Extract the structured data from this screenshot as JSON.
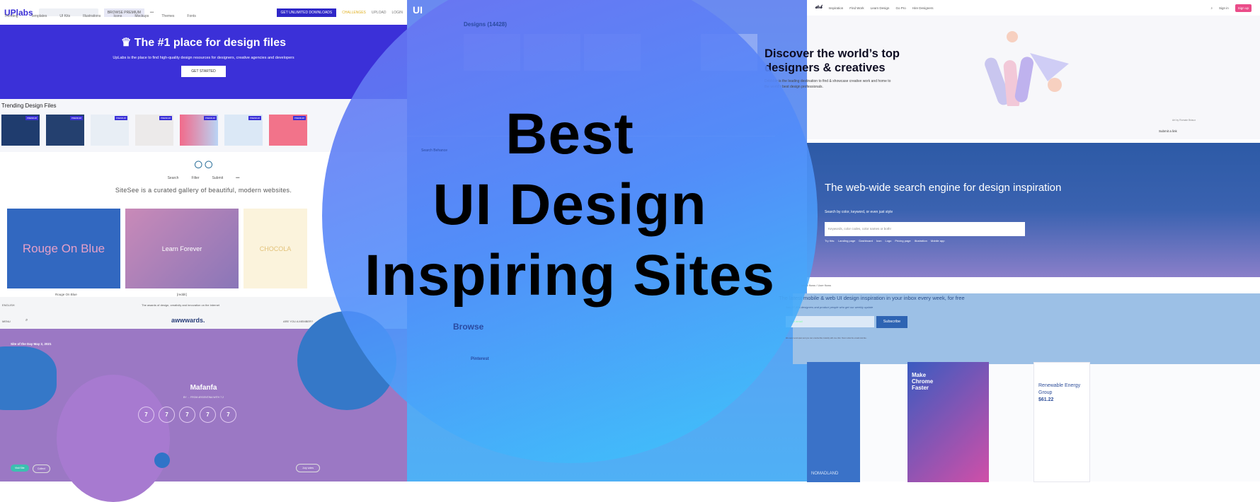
{
  "headline": {
    "line1": "Best",
    "line2": "UI Design",
    "line3": "Inspiring Sites"
  },
  "colors": {
    "circle_start": "#6e6ef0",
    "circle_end": "#3cc8fa",
    "uplabs_blue": "#3b30d8",
    "dribbble_pink": "#ea4c89"
  },
  "uplabs": {
    "logo": "UPlabs",
    "browse_premium": "BROWSE PREMIUM",
    "more": "•••",
    "get_unlimited": "GET UNLIMITED DOWNLOADS",
    "challenges": "CHALLENGES",
    "upload": "UPLOAD",
    "login": "LOGIN",
    "tabs": [
      "Trending",
      "Templates",
      "UI Kits",
      "Illustrations",
      "Icons",
      "Mockups",
      "Themes",
      "Fonts"
    ],
    "banner_title": "The #1 place for design files",
    "banner_text": "UpLabs is the place to find high-quality design resources for designers, creative agencies and developers",
    "cta": "GET STARTED",
    "trending_title": "Trending Design Files",
    "badge": "PREMIUM"
  },
  "sitesee": {
    "nav": [
      "Search",
      "Filter",
      "Submit",
      "•••"
    ],
    "tagline": "SiteSee is a curated gallery of beautiful, modern websites.",
    "shots": [
      {
        "title": "Rouge On Blue",
        "caption": "Rouge On Blue"
      },
      {
        "title": "Learn Forever",
        "caption": "[reddit]"
      },
      {
        "title": "CHOCOLA",
        "caption": ""
      }
    ]
  },
  "awwwards": {
    "language": "ENGLISH",
    "tagline": "The awards of design, creativity and innovation on the internet",
    "menu": "MENU",
    "logo": "awwwards.",
    "member": "ARE YOU A MEMBER?",
    "sotd": "Site of the Day May 2, 2021",
    "site": "Mafanfa",
    "byline": "BY … FROM ARGENTINA WITH 7.2",
    "scores": [
      "7",
      "7",
      "7",
      "7",
      "7"
    ],
    "visit": "Visit Site",
    "collect": "Collect",
    "jury": "Jury votes"
  },
  "middle": {
    "logo": "UI",
    "designs_title": "Designs (14428)",
    "search": "Search Behance",
    "browse": "Browse",
    "pinterest": "Pinterest"
  },
  "dribbble": {
    "nav": [
      "Inspiration",
      "Find Work",
      "Learn Design",
      "Go Pro",
      "Hire Designers"
    ],
    "signin": "Sign in",
    "signup": "Sign up",
    "title": "Discover the world’s top designers & creatives",
    "text": "Dribbble is the leading destination to find & showcase creative work and home to the world's best design professionals.",
    "art_credit": "Art by Romain Briaux",
    "submit": "Submit a link"
  },
  "search_engine": {
    "title": "The web-wide search engine for design inspiration",
    "subtitle": "Search by color, keyword, or even just style",
    "placeholder": "Keywords, color codes, color names or both!",
    "try_label": "Try this:",
    "try": [
      "Landing page",
      "Dashboard",
      "Icon",
      "Logo",
      "Pricing page",
      "Illustration",
      "Mobile app"
    ],
    "crumbs": "Inbox flows / User flows"
  },
  "newsletter": {
    "title": "The latest mobile & web UI design inspiration in your inbox every week, for free",
    "subtitle": "Join 27,686 designers and product people who get our weekly update",
    "email_placeholder": "Your email",
    "subscribe": "Subscribe",
    "fine": "We never send spam and you can unsubscribe instantly with one click. Here's what the emails look like.",
    "cards": [
      {
        "title": "NOMADLAND"
      },
      {
        "title": "Make Chrome Faster"
      },
      {
        "title": "Renewable Energy Group",
        "price": "$61.22"
      }
    ]
  }
}
